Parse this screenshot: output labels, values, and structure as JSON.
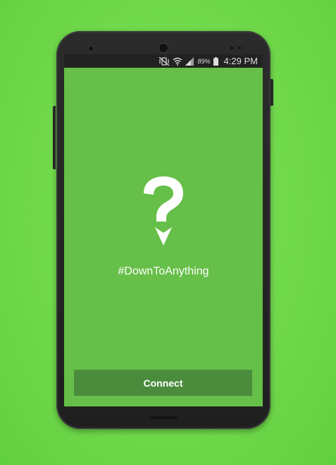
{
  "status_bar": {
    "icons": [
      "vibrate-mute-icon",
      "wifi-icon",
      "signal-icon",
      "battery-icon"
    ],
    "battery_percent": "89%",
    "time": "4:29 PM"
  },
  "main": {
    "logo_icon": "question-pin-icon",
    "tagline": "#DownToAnything"
  },
  "actions": {
    "connect_label": "Connect"
  },
  "colors": {
    "background": "#6fd84a",
    "screen": "#66bf48",
    "button": "#4a8c3c",
    "phone_body": "#222222",
    "text": "#ffffff"
  }
}
